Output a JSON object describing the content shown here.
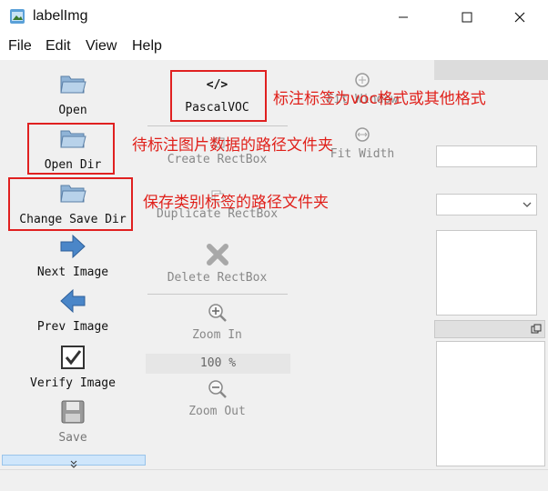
{
  "window": {
    "title": "labelImg"
  },
  "menu": [
    "File",
    "Edit",
    "View",
    "Help"
  ],
  "left_toolbar": [
    {
      "label": "Open",
      "icon": "folder-icon"
    },
    {
      "label": "Open Dir",
      "icon": "folder-icon"
    },
    {
      "label": "Change Save Dir",
      "icon": "folder-icon"
    },
    {
      "label": "Next Image",
      "icon": "arrow-right-icon"
    },
    {
      "label": "Prev Image",
      "icon": "arrow-left-icon"
    },
    {
      "label": "Verify Image",
      "icon": "checkbox-icon"
    },
    {
      "label": "Save",
      "icon": "save-icon"
    }
  ],
  "mid_toolbar": {
    "format": {
      "label": "PascalVOC",
      "icon": "code-icon"
    },
    "create": "Create RectBox",
    "duplicate": "Duplicate RectBox",
    "delete": "Delete RectBox",
    "zoom_in": "Zoom In",
    "zoom_value": "100 %",
    "zoom_out": "Zoom Out"
  },
  "right_toolbar": {
    "fit_window": "Fit Window",
    "fit_width": "Fit Width"
  },
  "annotations": {
    "format_note": "标注标签为voc格式或其他格式",
    "open_dir_note": "待标注图片数据的路径文件夹",
    "save_dir_note": "保存类别标签的路径文件夹"
  },
  "colors": {
    "annotation": "#e0201a",
    "highlight_box": "#e02020"
  }
}
